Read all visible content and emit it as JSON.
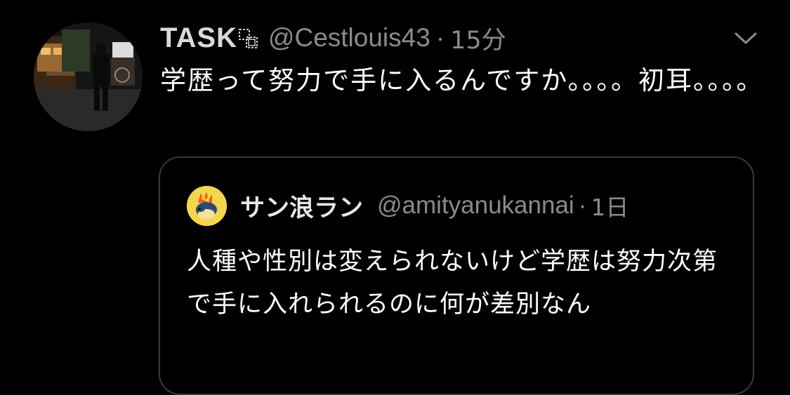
{
  "tweet": {
    "display_name": "TASK",
    "name_emoji_icon": "boxes-emoji-icon",
    "handle": "@Cestlouis43",
    "separator": "·",
    "time": "15分",
    "text": "学歴って努力で手に入るんですか。。。。初耳。。。。",
    "menu_icon": "chevron-down-icon"
  },
  "quote": {
    "display_name": "サン浪ラン",
    "handle": "@amityanukannai",
    "separator": "·",
    "time": "1日",
    "text": "人種や性別は変えられないけど学歴は努力次第で手に入れられるのに何が差別なん"
  },
  "colors": {
    "background": "#000000",
    "primary_text": "#ffffff",
    "secondary_text": "#8b8b8b",
    "border": "#3a3a3a"
  }
}
